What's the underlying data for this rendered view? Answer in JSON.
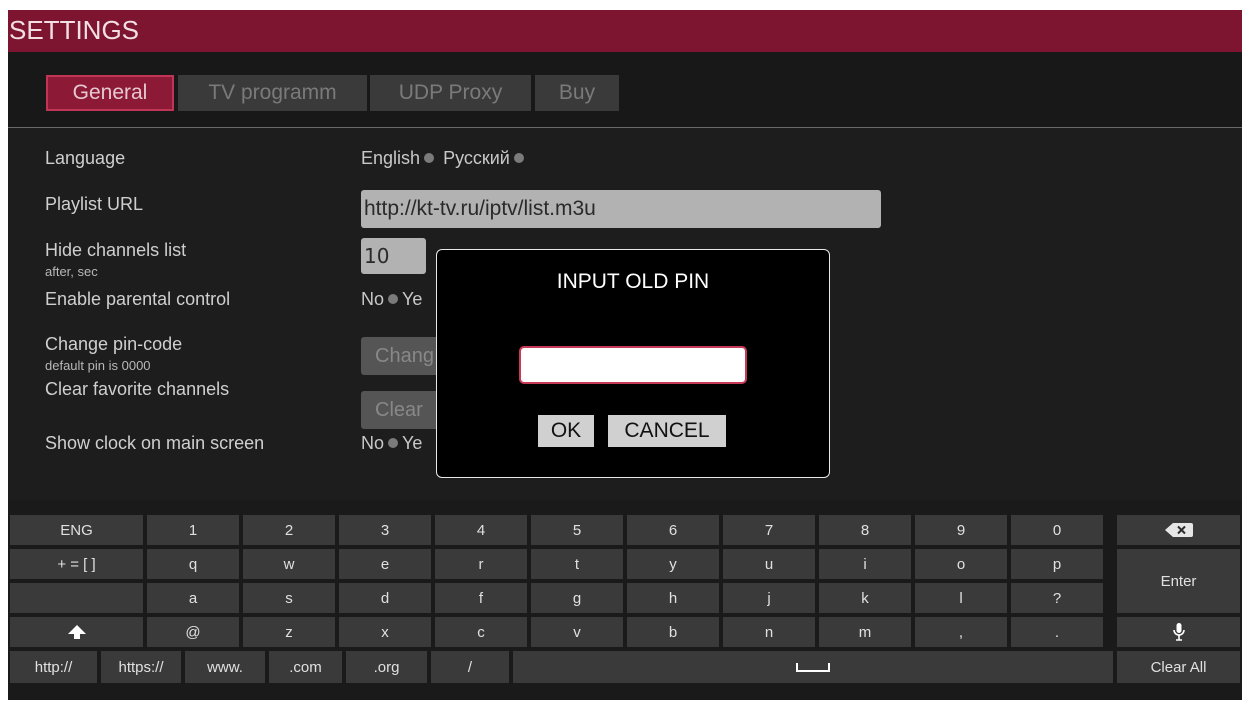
{
  "header": {
    "title": "SETTINGS"
  },
  "tabs": [
    {
      "label": "General",
      "active": true
    },
    {
      "label": "TV programm",
      "active": false
    },
    {
      "label": "UDP Proxy",
      "active": false
    },
    {
      "label": "Buy",
      "active": false
    }
  ],
  "settings": {
    "language": {
      "label": "Language",
      "option_english": "English",
      "option_russian": "Русский"
    },
    "playlist": {
      "label": "Playlist URL",
      "value": "http://kt-tv.ru/iptv/list.m3u"
    },
    "hide_channels": {
      "label": "Hide channels list",
      "sublabel": "after, sec",
      "value": "10"
    },
    "parental": {
      "label": "Enable parental control",
      "option_no": "No",
      "option_yes_partial": "Ye"
    },
    "change_pin": {
      "label": "Change pin-code",
      "sublabel": "default pin is 0000",
      "button_partial": "Chang"
    },
    "clear_fav": {
      "label": "Clear favorite channels",
      "button_partial": "Clear"
    },
    "show_clock": {
      "label": "Show clock on main screen",
      "option_no": "No",
      "option_yes_partial": "Ye"
    }
  },
  "modal": {
    "title": "INPUT OLD PIN",
    "input_value": "",
    "ok_label": "OK",
    "cancel_label": "CANCEL"
  },
  "keyboard": {
    "lang_key": "ENG",
    "symbols_key": "+ = [ ]",
    "row1": [
      "1",
      "2",
      "3",
      "4",
      "5",
      "6",
      "7",
      "8",
      "9",
      "0"
    ],
    "row2": [
      "q",
      "w",
      "e",
      "r",
      "t",
      "y",
      "u",
      "i",
      "o",
      "p"
    ],
    "row3": [
      "a",
      "s",
      "d",
      "f",
      "g",
      "h",
      "j",
      "k",
      "l",
      "?"
    ],
    "row4": [
      "@",
      "z",
      "x",
      "c",
      "v",
      "b",
      "n",
      "m",
      ",",
      "."
    ],
    "enter_label": "Enter",
    "clear_all_label": "Clear All",
    "backspace_icon": "backspace-icon",
    "shift_icon": "shift-arrow-icon",
    "mic_icon": "microphone-icon",
    "space_icon": "space-bar-icon",
    "shortcuts": [
      "http://",
      "https://",
      "www.",
      ".com",
      ".org",
      "/"
    ]
  },
  "colors": {
    "accent": "#7d1530",
    "active_tab": "#8c1a36",
    "panel_bg": "#1d1d1d",
    "key_bg": "#3a3a3a"
  }
}
